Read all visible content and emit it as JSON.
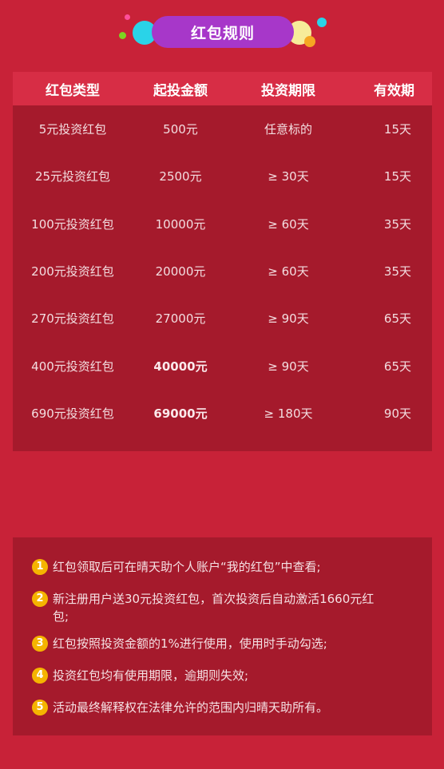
{
  "title": "红包规则",
  "colors": {
    "background": "#c82238",
    "panel": "#a51a2c",
    "header": "#d72d45",
    "title_pill": "#a737c9",
    "badge": "#f5b400"
  },
  "table": {
    "headers": [
      "红包类型",
      "起投金额",
      "投资期限",
      "有效期"
    ],
    "rows": [
      {
        "type": "5元投资红包",
        "amount": "500元",
        "term": "任意标的",
        "valid": "15天"
      },
      {
        "type": "25元投资红包",
        "amount": "2500元",
        "term": "≥ 30天",
        "valid": "15天"
      },
      {
        "type": "100元投资红包",
        "amount": "10000元",
        "term": "≥ 60天",
        "valid": "35天"
      },
      {
        "type": "200元投资红包",
        "amount": "20000元",
        "term": "≥ 60天",
        "valid": "35天"
      },
      {
        "type": "270元投资红包",
        "amount": "27000元",
        "term": "≥ 90天",
        "valid": "65天"
      },
      {
        "type": "400元投资红包",
        "amount": "40000元",
        "term": "≥ 90天",
        "valid": "65天"
      },
      {
        "type": "690元投资红包",
        "amount": "69000元",
        "term": "≥ 180天",
        "valid": "90天"
      }
    ]
  },
  "notes": [
    {
      "num": "1",
      "text": "红包领取后可在晴天助个人账户“我的红包”中查看;"
    },
    {
      "num": "2",
      "text": "新注册用户送30元投资红包，首次投资后自动激活1660元红包;"
    },
    {
      "num": "3",
      "text": "红包按照投资金额的1%进行使用，使用时手动勾选;"
    },
    {
      "num": "4",
      "text": "投资红包均有使用期限，逾期则失效;"
    },
    {
      "num": "5",
      "text": "活动最终解释权在法律允许的范围内归晴天助所有。"
    }
  ]
}
